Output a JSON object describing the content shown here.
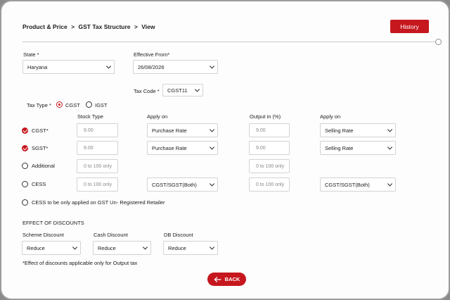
{
  "breadcrumb": [
    "Product & Price",
    ">",
    "GST Tax Structure",
    ">",
    "View"
  ],
  "header": {
    "history_label": "History"
  },
  "state": {
    "label": "State *",
    "value": "Haryana"
  },
  "effective_from": {
    "label": "Effective From*",
    "value": "26/08/2026"
  },
  "tax_code": {
    "label": "Tax Code *",
    "value": "CGST11"
  },
  "tax_type": {
    "label": "Tax Type *",
    "options": [
      "CGST",
      "IGST"
    ],
    "selected": "CGST"
  },
  "columns": {
    "stock_type": "Stock Type",
    "apply_on_1": "Apply on",
    "output_in": "Output in (%)",
    "apply_on_2": "Apply on"
  },
  "rows": [
    {
      "label": "CGST*",
      "checked": true,
      "stock_value": "9.00",
      "apply_on": "Purchase Rate",
      "output_value": "9.00",
      "apply_on_output": "Selling Rate"
    },
    {
      "label": "SGST*",
      "checked": true,
      "stock_value": "9.00",
      "apply_on": "Purchase Rate",
      "output_value": "9.00",
      "apply_on_output": "Selling Rate"
    },
    {
      "label": "Additional",
      "checked": false,
      "stock_placeholder": "0 to 100 only",
      "output_placeholder": "0 to 100 only"
    },
    {
      "label": "CESS",
      "checked": false,
      "stock_placeholder": "0 to 100 only",
      "apply_on": "CGST/SGST(Both)",
      "output_placeholder": "0 to 100 only",
      "apply_on_output": "CGST/SGST(Both)"
    }
  ],
  "cess_unregistered": {
    "label": "CESS to be only applied on GST Un- Registered Retailer"
  },
  "discounts": {
    "section_title": "EFFECT OF DISCOUNTS",
    "scheme": {
      "label": "Scheme Discount",
      "value": "Reduce"
    },
    "cash": {
      "label": "Cash Discount",
      "value": "Reduce"
    },
    "db": {
      "label": "DB Discount",
      "value": "Reduce"
    },
    "note": "*Effect of discounts applicable only for Output tax"
  },
  "footer": {
    "back_label": "BACK"
  },
  "colors": {
    "accent": "#c6171e",
    "border": "#d3d3d3"
  }
}
